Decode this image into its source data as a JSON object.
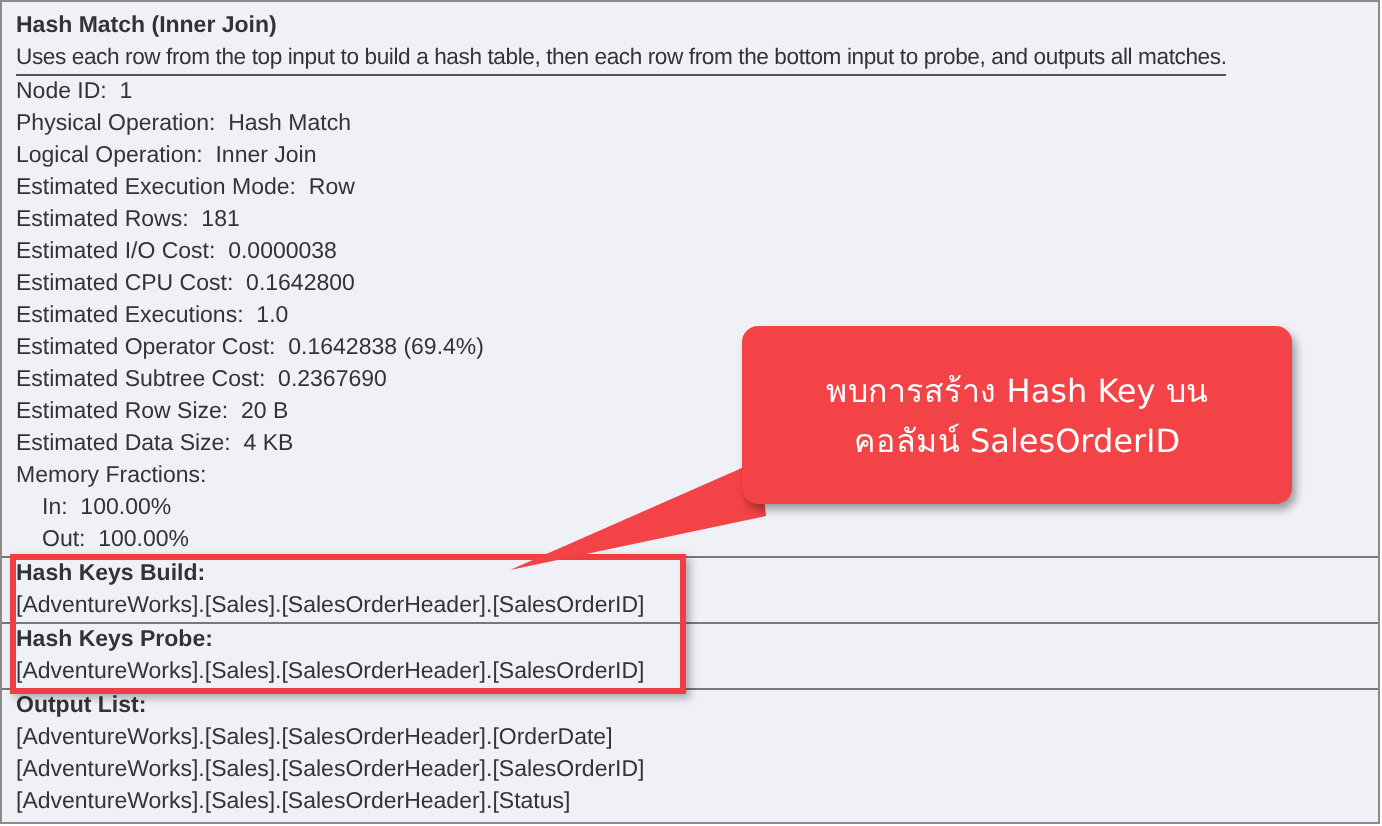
{
  "title": "Hash Match (Inner Join)",
  "description": "Uses each row from the top input to build a hash table, then each row from the bottom input to probe, and outputs all matches.",
  "properties": [
    {
      "label": "Node ID:",
      "value": "1"
    },
    {
      "label": "Physical Operation:",
      "value": "Hash Match"
    },
    {
      "label": "Logical Operation:",
      "value": "Inner Join"
    },
    {
      "label": "Estimated Execution Mode:",
      "value": "Row"
    },
    {
      "label": "Estimated Rows:",
      "value": "181"
    },
    {
      "label": "Estimated I/O Cost:",
      "value": "0.0000038"
    },
    {
      "label": "Estimated CPU Cost:",
      "value": "0.1642800"
    },
    {
      "label": "Estimated Executions:",
      "value": "1.0"
    },
    {
      "label": "Estimated Operator Cost:",
      "value": "0.1642838 (69.4%)"
    },
    {
      "label": "Estimated Subtree Cost:",
      "value": "0.2367690"
    },
    {
      "label": "Estimated Row Size:",
      "value": "20 B"
    },
    {
      "label": "Estimated Data Size:",
      "value": "4 KB"
    },
    {
      "label": "Memory Fractions:",
      "children": [
        {
          "label": "In:",
          "value": "100.00%"
        },
        {
          "label": "Out:",
          "value": "100.00%"
        }
      ]
    }
  ],
  "sections": [
    {
      "heading": "Hash Keys Build:",
      "values": [
        "[AdventureWorks].[Sales].[SalesOrderHeader].[SalesOrderID]"
      ]
    },
    {
      "heading": "Hash Keys Probe:",
      "values": [
        "[AdventureWorks].[Sales].[SalesOrderHeader].[SalesOrderID]"
      ]
    },
    {
      "heading": "Output List:",
      "values": [
        "[AdventureWorks].[Sales].[SalesOrderHeader].[OrderDate]",
        "[AdventureWorks].[Sales].[SalesOrderHeader].[SalesOrderID]",
        "[AdventureWorks].[Sales].[SalesOrderHeader].[Status]"
      ]
    }
  ],
  "callout": {
    "lines": [
      "พบการสร้าง Hash Key บน",
      "คอลัมน์ SalesOrderID"
    ]
  }
}
